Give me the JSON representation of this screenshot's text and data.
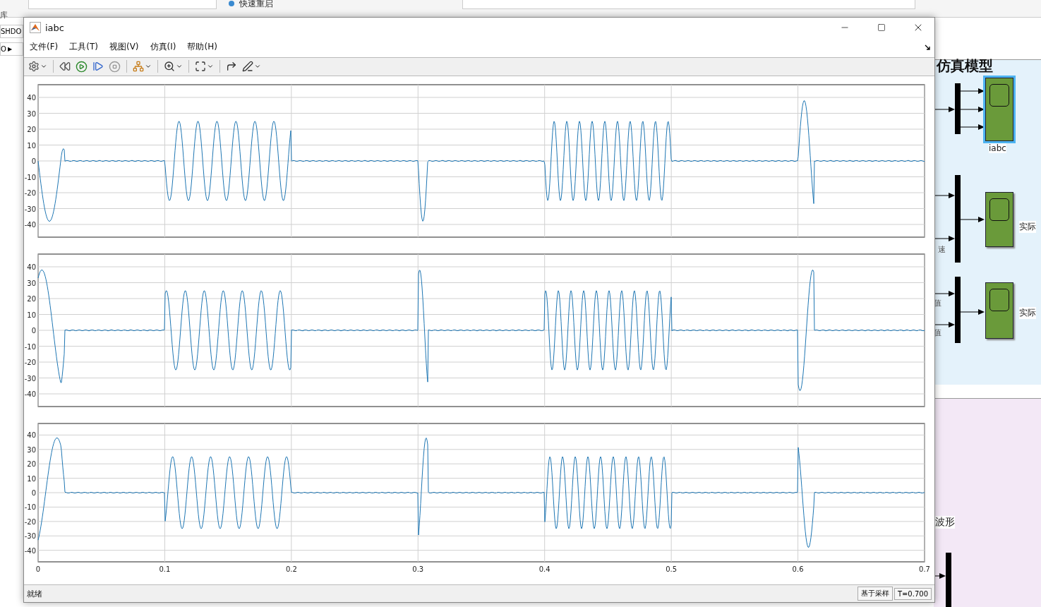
{
  "editor": {
    "toolstrip": {
      "restart_label": "快速重启"
    },
    "library_label": "库",
    "side_items": [
      "SHDO",
      "O"
    ],
    "side_arrow": "▶",
    "model_title": "仿真模型",
    "scopes": [
      {
        "label": "iabc",
        "selected": true
      },
      {
        "label": "实际",
        "selected": false
      },
      {
        "label": "实际",
        "selected": false
      }
    ],
    "signal_labels": [
      "速",
      "值",
      "值"
    ],
    "section_label": "波形"
  },
  "window": {
    "title": "iabc"
  },
  "menu": [
    "文件(F)",
    "工具(T)",
    "视图(V)",
    "仿真(I)",
    "帮助(H)"
  ],
  "plots": [
    {
      "yticks": [
        "40",
        "30",
        "20",
        "10",
        "0",
        "-10",
        "-20",
        "-30",
        "-40"
      ]
    },
    {
      "yticks": [
        "40",
        "30",
        "20",
        "10",
        "0",
        "-10",
        "-20",
        "-30",
        "-40"
      ]
    },
    {
      "yticks": [
        "40",
        "30",
        "20",
        "10",
        "0",
        "-10",
        "-20",
        "-30",
        "-40"
      ]
    }
  ],
  "x_axis": {
    "ticks": [
      "0",
      "0.1",
      "0.2",
      "0.3",
      "0.4",
      "0.5",
      "0.6",
      "0.7"
    ]
  },
  "status": {
    "text": "就绪",
    "mode": "基于采样",
    "time": "T=0.700"
  }
}
